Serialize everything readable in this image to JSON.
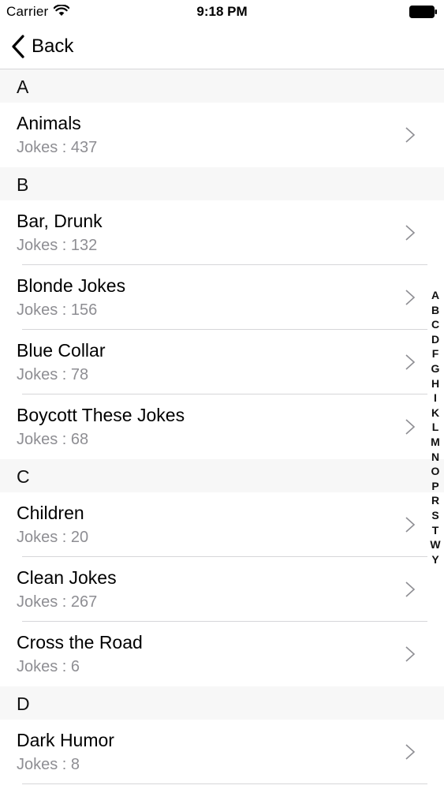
{
  "status_bar": {
    "carrier": "Carrier",
    "time": "9:18 PM"
  },
  "nav": {
    "back_label": "Back"
  },
  "sections": [
    {
      "letter": "A",
      "rows": [
        {
          "title": "Animals",
          "subtitle": "Jokes : 437"
        }
      ]
    },
    {
      "letter": "B",
      "rows": [
        {
          "title": "Bar, Drunk",
          "subtitle": "Jokes : 132"
        },
        {
          "title": "Blonde Jokes",
          "subtitle": "Jokes : 156"
        },
        {
          "title": "Blue Collar",
          "subtitle": "Jokes : 78"
        },
        {
          "title": "Boycott These Jokes",
          "subtitle": "Jokes : 68"
        }
      ]
    },
    {
      "letter": "C",
      "rows": [
        {
          "title": "Children",
          "subtitle": "Jokes : 20"
        },
        {
          "title": "Clean Jokes",
          "subtitle": "Jokes : 267"
        },
        {
          "title": "Cross the Road",
          "subtitle": "Jokes : 6"
        }
      ]
    },
    {
      "letter": "D",
      "rows": [
        {
          "title": "Dark Humor",
          "subtitle": "Jokes : 8"
        }
      ]
    }
  ],
  "index_letters": [
    "A",
    "B",
    "C",
    "D",
    "F",
    "G",
    "H",
    "I",
    "K",
    "L",
    "M",
    "N",
    "O",
    "P",
    "R",
    "S",
    "T",
    "W",
    "Y"
  ],
  "colors": {
    "text_primary": "#000000",
    "text_secondary": "#8e8e93",
    "section_background": "#f7f7f7",
    "separator": "#d6d6d9",
    "chevron": "#c7c7cc"
  }
}
